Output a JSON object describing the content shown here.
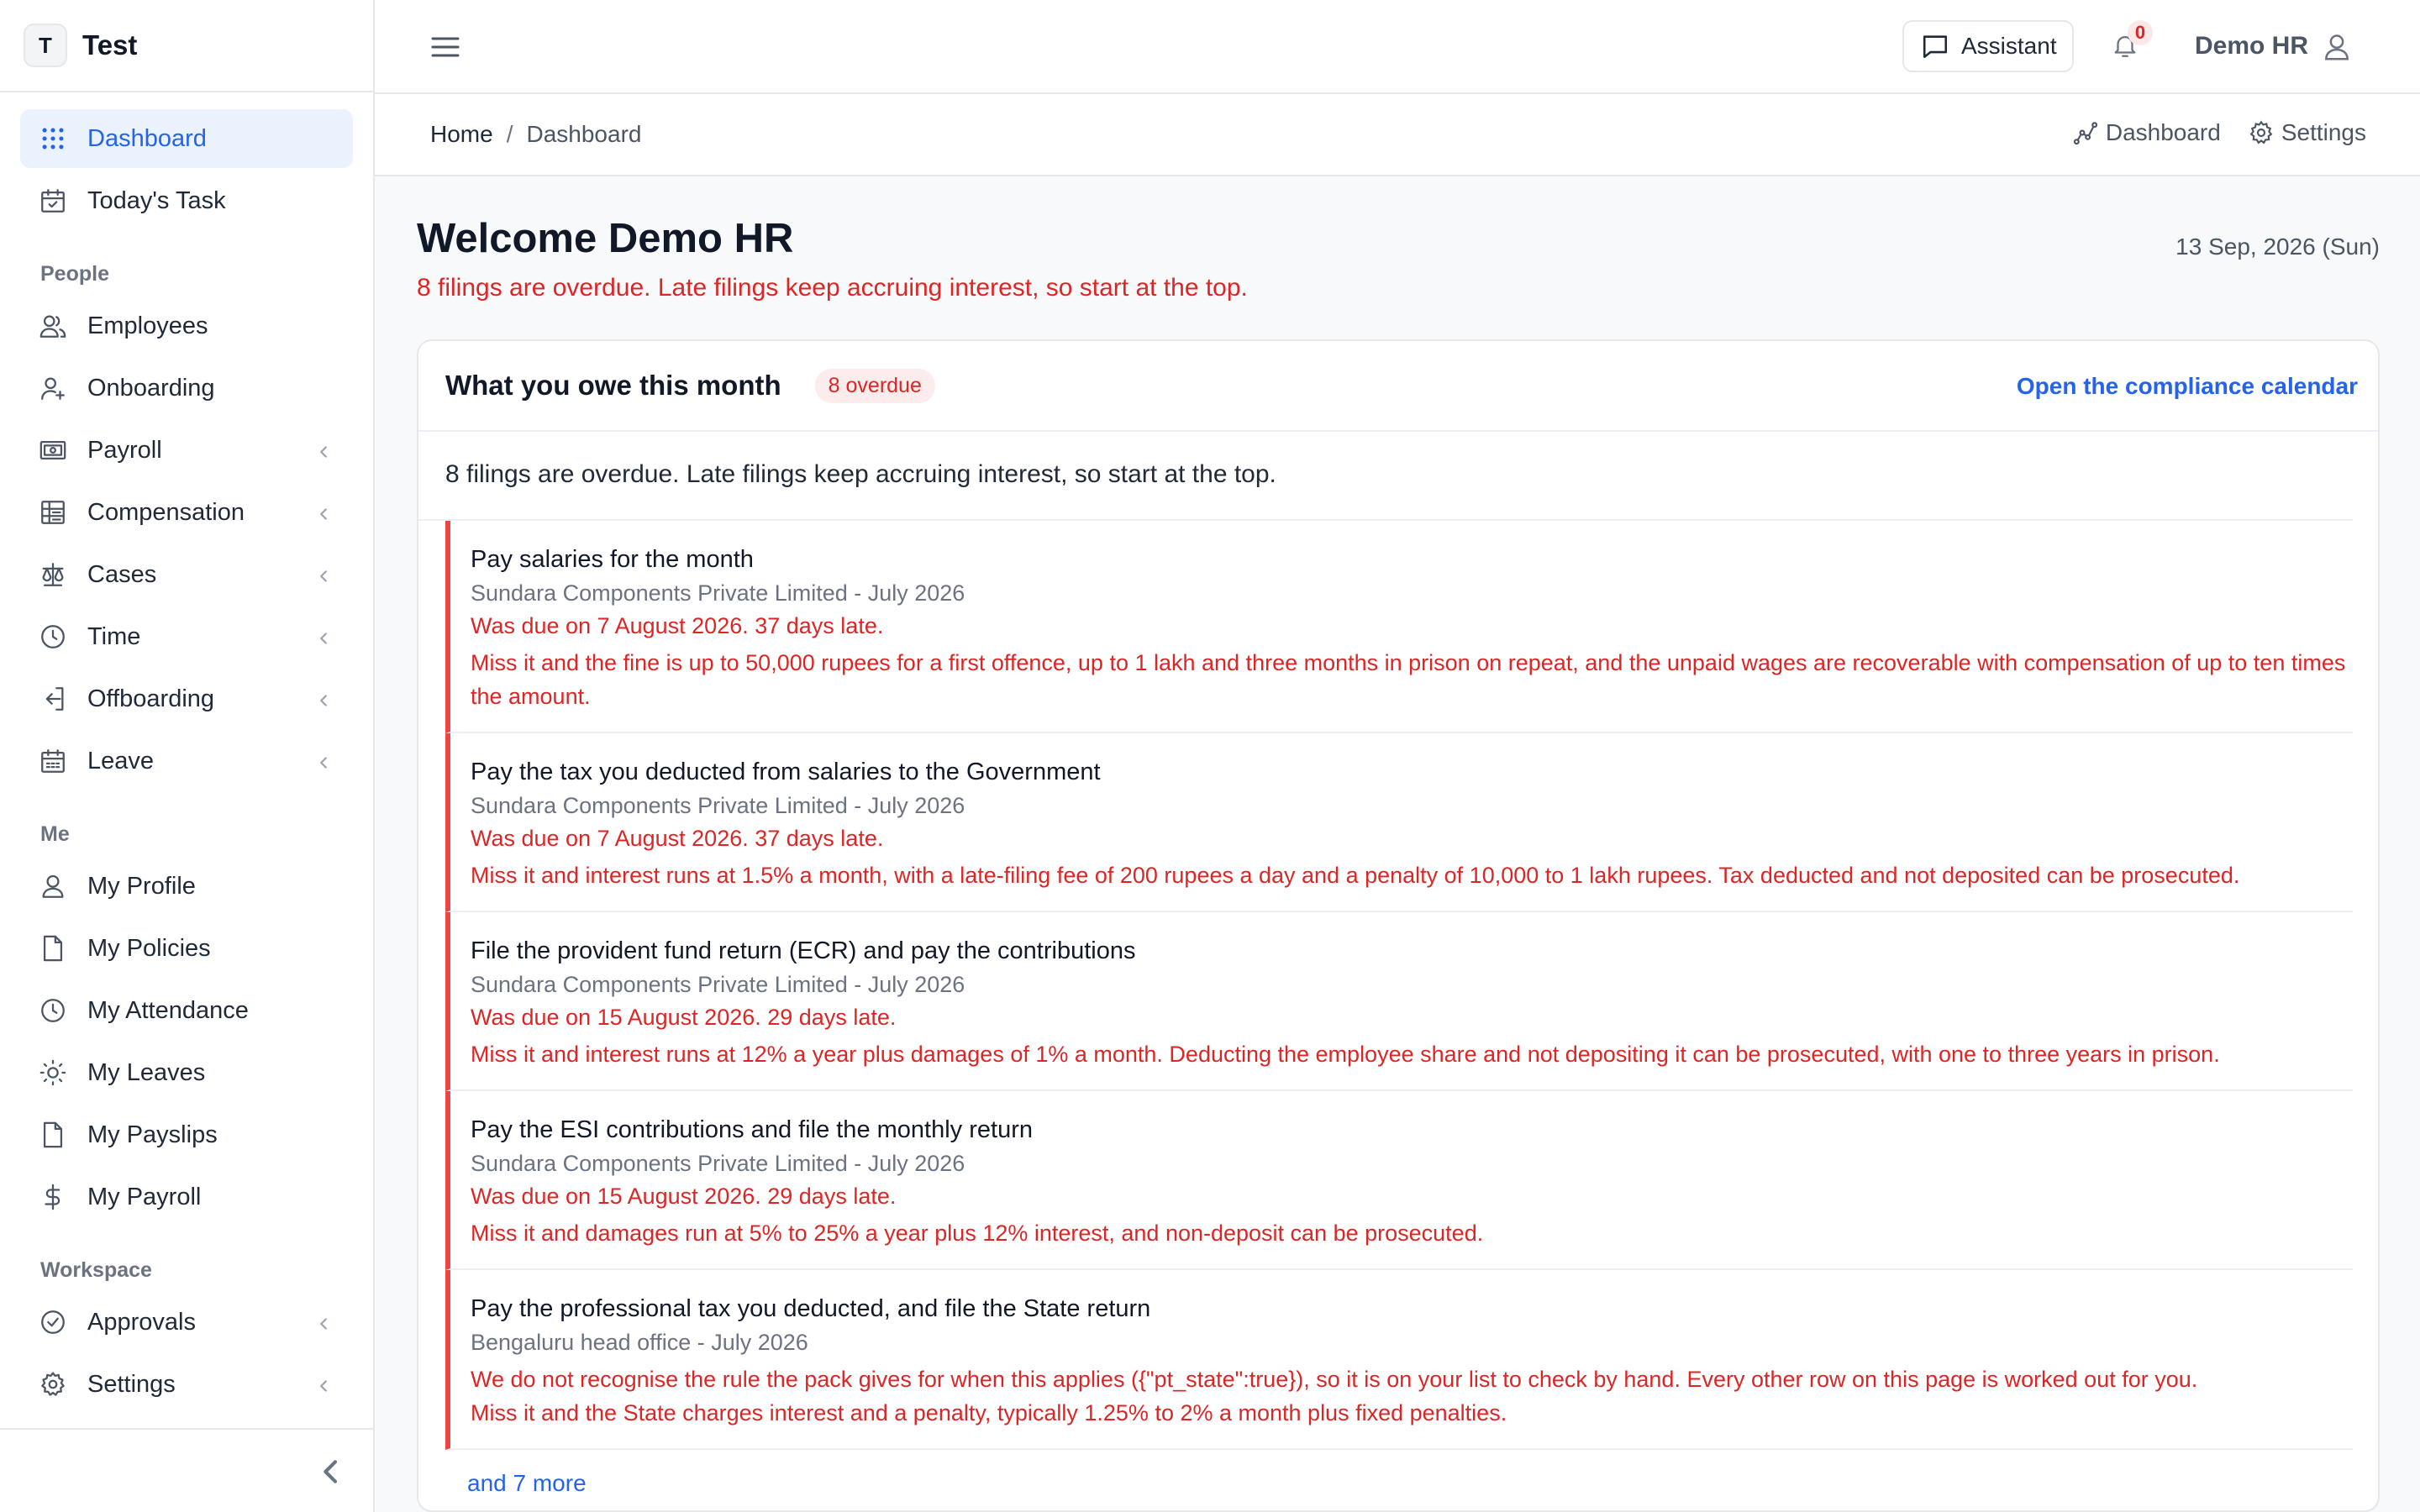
{
  "brand": {
    "mark": "T",
    "name": "Test"
  },
  "sidebar": {
    "top_items": [
      {
        "label": "Dashboard",
        "icon": "grid-dots-icon",
        "active": true
      },
      {
        "label": "Today's Task",
        "icon": "calendar-check-icon"
      }
    ],
    "sections": [
      {
        "title": "People",
        "items": [
          {
            "label": "Employees",
            "icon": "users-icon"
          },
          {
            "label": "Onboarding",
            "icon": "user-plus-icon"
          },
          {
            "label": "Payroll",
            "icon": "banknote-icon",
            "expandable": true
          },
          {
            "label": "Compensation",
            "icon": "table-icon",
            "expandable": true
          },
          {
            "label": "Cases",
            "icon": "scale-icon",
            "expandable": true
          },
          {
            "label": "Time",
            "icon": "clock-icon",
            "expandable": true
          },
          {
            "label": "Offboarding",
            "icon": "log-out-icon",
            "expandable": true
          },
          {
            "label": "Leave",
            "icon": "calendar-icon",
            "expandable": true
          }
        ]
      },
      {
        "title": "Me",
        "items": [
          {
            "label": "My Profile",
            "icon": "user-icon"
          },
          {
            "label": "My Policies",
            "icon": "file-icon"
          },
          {
            "label": "My Attendance",
            "icon": "clock-icon"
          },
          {
            "label": "My Leaves",
            "icon": "sun-icon"
          },
          {
            "label": "My Payslips",
            "icon": "file-icon"
          },
          {
            "label": "My Payroll",
            "icon": "dollar-icon"
          }
        ]
      },
      {
        "title": "Workspace",
        "items": [
          {
            "label": "Approvals",
            "icon": "check-circle-icon",
            "expandable": true
          },
          {
            "label": "Settings",
            "icon": "gear-icon",
            "expandable": true
          }
        ]
      }
    ]
  },
  "topbar": {
    "assistant_label": "Assistant",
    "notification_count": "0",
    "user_name": "Demo HR"
  },
  "breadcrumb": {
    "home": "Home",
    "separator": "/",
    "current": "Dashboard",
    "actions": [
      "Dashboard",
      "Settings"
    ]
  },
  "main": {
    "welcome": "Welcome Demo HR",
    "subtitle": "8 filings are overdue. Late filings keep accruing interest, so start at the top.",
    "date": "13 Sep, 2026 (Sun)"
  },
  "card": {
    "title": "What you owe this month",
    "badge": "8 overdue",
    "calendar_link": "Open the compliance calendar",
    "intro": "8 filings are overdue. Late filings keep accruing interest, so start at the top.",
    "items": [
      {
        "title": "Pay salaries for the month",
        "entity": "Sundara Components Private Limited - July 2026",
        "due": "Was due on 7 August 2026. 37 days late.",
        "notes": [
          "Miss it and the fine is up to 50,000 rupees for a first offence, up to 1 lakh and three months in prison on repeat, and the unpaid wages are recoverable with compensation of up to ten times the amount."
        ]
      },
      {
        "title": "Pay the tax you deducted from salaries to the Government",
        "entity": "Sundara Components Private Limited - July 2026",
        "due": "Was due on 7 August 2026. 37 days late.",
        "notes": [
          "Miss it and interest runs at 1.5% a month, with a late-filing fee of 200 rupees a day and a penalty of 10,000 to 1 lakh rupees. Tax deducted and not deposited can be prosecuted."
        ]
      },
      {
        "title": "File the provident fund return (ECR) and pay the contributions",
        "entity": "Sundara Components Private Limited - July 2026",
        "due": "Was due on 15 August 2026. 29 days late.",
        "notes": [
          "Miss it and interest runs at 12% a year plus damages of 1% a month. Deducting the employee share and not depositing it can be prosecuted, with one to three years in prison."
        ]
      },
      {
        "title": "Pay the ESI contributions and file the monthly return",
        "entity": "Sundara Components Private Limited - July 2026",
        "due": "Was due on 15 August 2026. 29 days late.",
        "notes": [
          "Miss it and damages run at 5% to 25% a year plus 12% interest, and non-deposit can be prosecuted."
        ]
      },
      {
        "title": "Pay the professional tax you deducted, and file the State return",
        "entity": "Bengaluru head office - July 2026",
        "due": "",
        "notes": [
          "We do not recognise the rule the pack gives for when this applies ({\"pt_state\":true}), so it is on your list to check by hand. Every other row on this page is worked out for you.",
          "Miss it and the State charges interest and a penalty, typically 1.25% to 2% a month plus fixed penalties."
        ]
      }
    ],
    "more_link": "and 7 more"
  },
  "colors": {
    "accent": "#2563eb",
    "danger": "#dc2626",
    "active_bg": "#eaf2fe"
  }
}
